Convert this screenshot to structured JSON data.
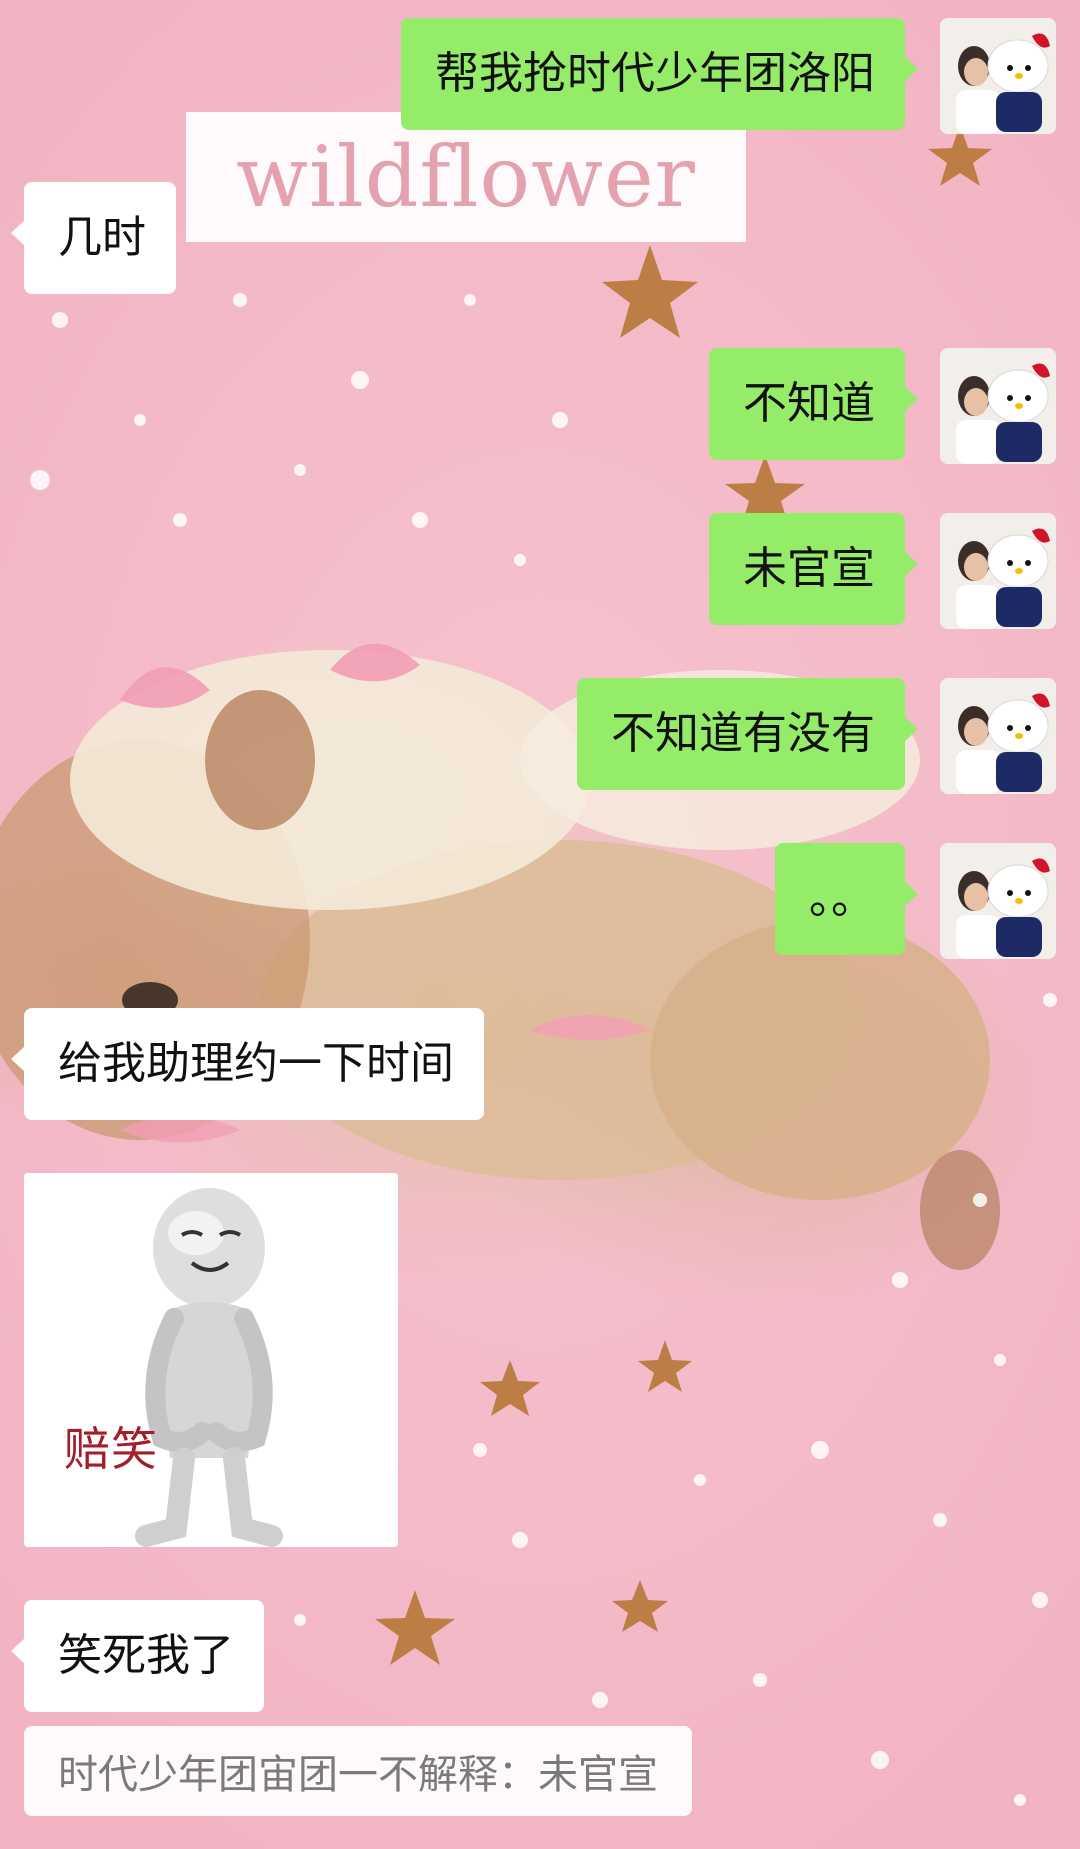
{
  "wallpaper": {
    "brand_text": "wildflower"
  },
  "messages": [
    {
      "id": 1,
      "direction": "out",
      "text": "帮我抢时代少年团洛阳"
    },
    {
      "id": 2,
      "direction": "in",
      "text": "几时"
    },
    {
      "id": 3,
      "direction": "out",
      "text": "不知道"
    },
    {
      "id": 4,
      "direction": "out",
      "text": "未官宣"
    },
    {
      "id": 5,
      "direction": "out",
      "text": "不知道有没有"
    },
    {
      "id": 6,
      "direction": "out",
      "text": "。。"
    },
    {
      "id": 7,
      "direction": "in",
      "text": "给我助理约一下时间"
    },
    {
      "id": 8,
      "direction": "in",
      "type": "sticker",
      "caption": "赔笑"
    },
    {
      "id": 9,
      "direction": "in",
      "text": "笑死我了"
    }
  ],
  "quote": {
    "text": "时代少年团宙团一不解释：未官宣"
  },
  "colors": {
    "outgoing_bubble": "#95ec69",
    "incoming_bubble": "#ffffff",
    "wallpaper_pink": "#f3b9c6"
  }
}
